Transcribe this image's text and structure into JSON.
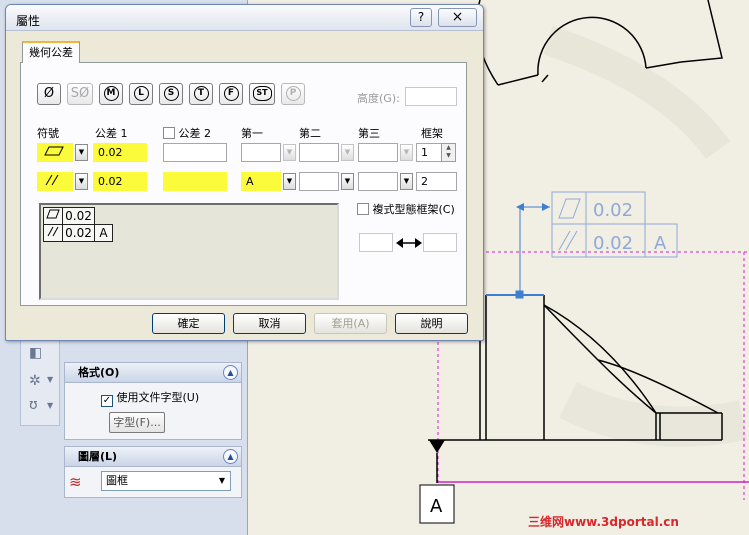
{
  "dialog": {
    "title": "屬性",
    "help_button": "?",
    "close_button": "×",
    "tab": "幾何公差",
    "symbols": [
      "Ø",
      "SØ",
      "M",
      "L",
      "S",
      "T",
      "F",
      "ST",
      "P"
    ],
    "height_label": "高度(G):",
    "headers": {
      "symbol": "符號",
      "tol1": "公差 1",
      "tol2": "公差 2",
      "primary": "第一",
      "secondary": "第二",
      "tertiary": "第三",
      "frame": "框架"
    },
    "row1": {
      "tolerance1": "0.02",
      "frame": "1"
    },
    "row2": {
      "tolerance1": "0.02",
      "primary": "A",
      "frame": "2"
    },
    "preview": {
      "row1": {
        "tol": "0.02"
      },
      "row2": {
        "tol": "0.02",
        "datum": "A"
      }
    },
    "composite_frame_label": "複式型態框架(C)",
    "buttons": {
      "ok": "確定",
      "cancel": "取消",
      "apply": "套用(A)",
      "help": "說明"
    }
  },
  "panel": {
    "format_group": {
      "title": "格式(O)",
      "use_doc_font_label": "使用文件字型(U)",
      "font_button": "字型(F)..."
    },
    "layer_group": {
      "title": "圖層(L)",
      "layer_value": "圖框"
    }
  },
  "drawing": {
    "fcf_row1_value": "0.02",
    "fcf_row2_value": "0.02",
    "fcf_row2_datum": "A",
    "datum_label": "A",
    "watermark": "三维网www.3dportal.cn"
  },
  "colors": {
    "highlight": "#fbfb3c",
    "annotation_blue": "#3f7fd1",
    "guide_magenta": "#d21fd2",
    "watermark_red": "#d9282c"
  }
}
